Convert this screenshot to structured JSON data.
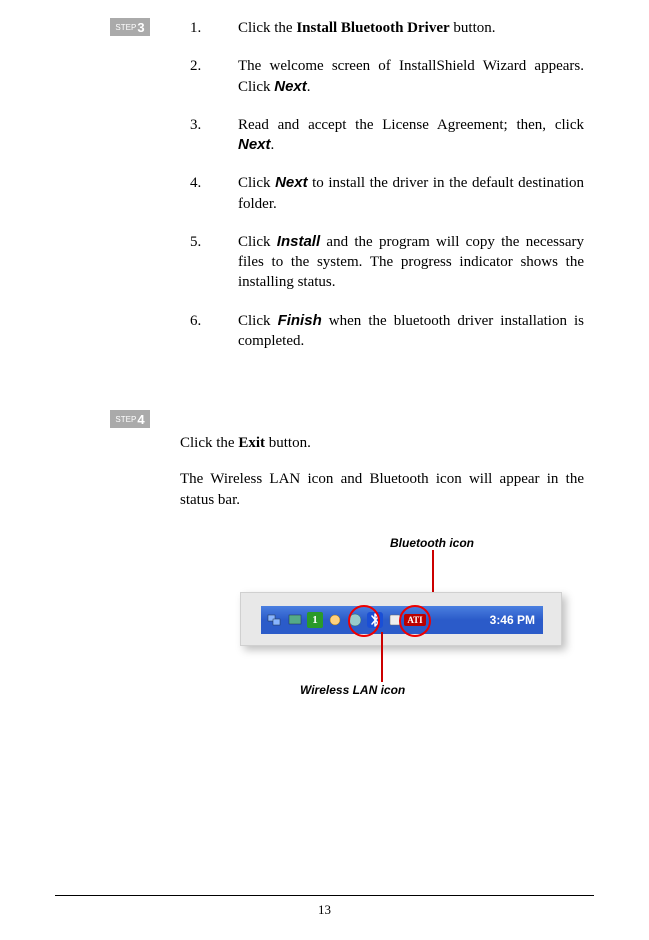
{
  "step3": {
    "badge_label": "STEP",
    "badge_num": "3",
    "items": [
      {
        "pre": "Click the ",
        "bold": "Install Bluetooth Driver",
        "post": " button."
      },
      {
        "pre": "The welcome screen of InstallShield Wizard appears. Click ",
        "boldi": "Next",
        "post": "."
      },
      {
        "pre": "Read and accept the License Agreement; then, click ",
        "boldi": "Next",
        "post": "."
      },
      {
        "pre": "Click ",
        "boldi": "Next",
        "post": " to install the driver in the default destination folder."
      },
      {
        "pre": "Click ",
        "boldi": "Install",
        "post": " and the program will copy the necessary files to the system.  The progress indicator shows the installing status."
      },
      {
        "pre": "Click ",
        "boldi": "Finish",
        "post": " when the bluetooth driver installation is completed."
      }
    ]
  },
  "step4": {
    "badge_label": "STEP",
    "badge_num": "4",
    "line1_pre": "Click the ",
    "line1_bold": "Exit",
    "line1_post": " button.",
    "line2": "The Wireless LAN icon and Bluetooth icon will appear in the status bar."
  },
  "figure": {
    "bluetooth_label": "Bluetooth icon",
    "wireless_label": "Wireless LAN icon",
    "clock": "3:46 PM",
    "wlan_glyph": "1",
    "ati": "ATI"
  },
  "page_number": "13"
}
